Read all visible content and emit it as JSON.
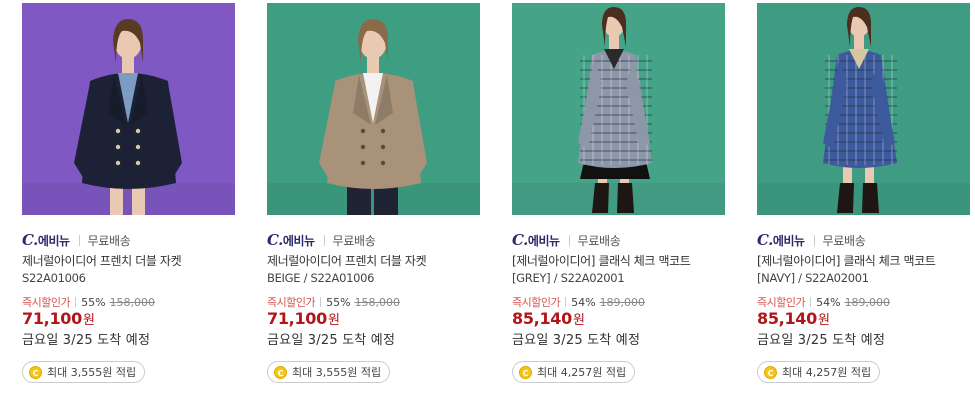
{
  "products": [
    {
      "brand_mark": "C.",
      "brand_rest": "에비뉴",
      "shipping": "무료배송",
      "name": "제너럴아이디어 프렌치 더블 자켓",
      "code": "S22A01006",
      "discount_label": "즉시할인가",
      "discount_rate": "55%",
      "original_price": "158,000",
      "price": "71,100",
      "currency": "원",
      "eta": "금요일 3/25 도착 예정",
      "points": "최대 3,555원 적립",
      "coin_symbol": "C",
      "photo_bg": "#7f58c4",
      "garment_color": "#1c2136",
      "garment_style": "jacket"
    },
    {
      "brand_mark": "C.",
      "brand_rest": "에비뉴",
      "shipping": "무료배송",
      "name": "제너럴아이디어 프렌치 더블 자켓",
      "code": "BEIGE / S22A01006",
      "discount_label": "즉시할인가",
      "discount_rate": "55%",
      "original_price": "158,000",
      "price": "71,100",
      "currency": "원",
      "eta": "금요일 3/25 도착 예정",
      "points": "최대 3,555원 적립",
      "coin_symbol": "C",
      "photo_bg": "#3e9e82",
      "garment_color": "#a8927a",
      "garment_style": "jacket"
    },
    {
      "brand_mark": "C.",
      "brand_rest": "에비뉴",
      "shipping": "무료배송",
      "name": "[제너럴아이디어] 클래식 체크 맥코트",
      "code": "[GREY] / S22A02001",
      "discount_label": "즉시할인가",
      "discount_rate": "54%",
      "original_price": "189,000",
      "price": "85,140",
      "currency": "원",
      "eta": "금요일 3/25 도착 예정",
      "points": "최대 4,257원 적립",
      "coin_symbol": "C",
      "photo_bg": "#45a388",
      "garment_color": "#8e97a8",
      "garment_style": "coat"
    },
    {
      "brand_mark": "C.",
      "brand_rest": "에비뉴",
      "shipping": "무료배송",
      "name": "[제너럴아이디어] 클래식 체크 맥코트",
      "code": "[NAVY] / S22A02001",
      "discount_label": "즉시할인가",
      "discount_rate": "54%",
      "original_price": "189,000",
      "price": "85,140",
      "currency": "원",
      "eta": "금요일 3/25 도착 예정",
      "points": "최대 4,257원 적립",
      "coin_symbol": "C",
      "photo_bg": "#3f9c83",
      "garment_color": "#3d5a9c",
      "garment_style": "coat"
    }
  ]
}
